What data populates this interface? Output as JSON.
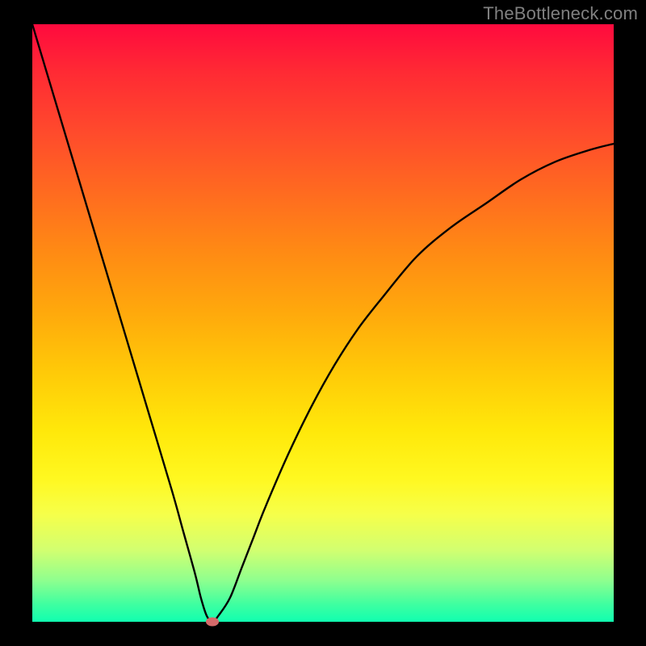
{
  "watermark": "TheBottleneck.com",
  "colors": {
    "frame": "#000000",
    "curve": "#000000",
    "marker": "#d46a6a",
    "gradient_top": "#ff0a3e",
    "gradient_bottom": "#10ffb0"
  },
  "chart_data": {
    "type": "line",
    "title": "",
    "xlabel": "",
    "ylabel": "",
    "xlim": [
      0,
      100
    ],
    "ylim": [
      0,
      100
    ],
    "grid": false,
    "legend": false,
    "series": [
      {
        "name": "bottleneck-curve",
        "x": [
          0,
          4,
          8,
          12,
          16,
          20,
          24,
          26,
          28,
          29,
          30,
          31,
          32,
          34,
          36,
          38,
          40,
          44,
          48,
          52,
          56,
          60,
          66,
          72,
          78,
          84,
          90,
          96,
          100
        ],
        "y": [
          100,
          87,
          74,
          61,
          48,
          35,
          22,
          15,
          8,
          4,
          1,
          0,
          1,
          4,
          9,
          14,
          19,
          28,
          36,
          43,
          49,
          54,
          61,
          66,
          70,
          74,
          77,
          79,
          80
        ]
      }
    ],
    "marker": {
      "x": 31,
      "y": 0
    },
    "background_gradient": {
      "orientation": "vertical",
      "stops": [
        {
          "pos": 0.0,
          "color": "#ff0a3e"
        },
        {
          "pos": 0.38,
          "color": "#ff8a14"
        },
        {
          "pos": 0.68,
          "color": "#ffe80a"
        },
        {
          "pos": 0.88,
          "color": "#d2ff70"
        },
        {
          "pos": 1.0,
          "color": "#10ffb0"
        }
      ]
    }
  }
}
